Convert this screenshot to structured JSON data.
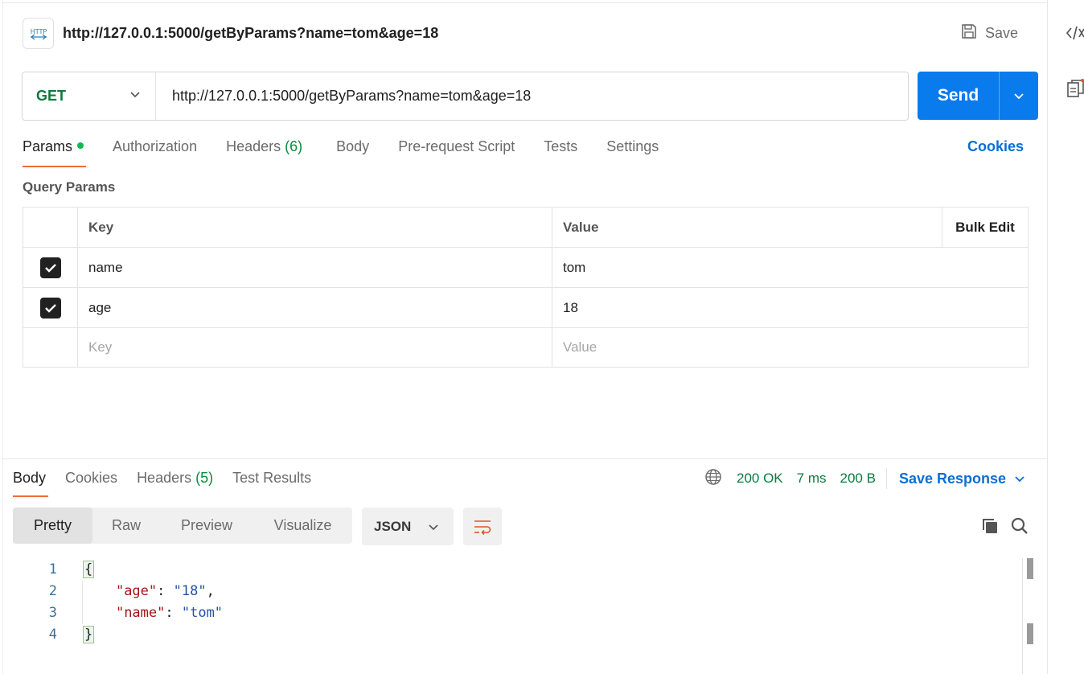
{
  "header": {
    "badge_text": "HTTP",
    "request_title": "http://127.0.0.1:5000/getByParams?name=tom&age=18",
    "save_label": "Save"
  },
  "request": {
    "method": "GET",
    "url": "http://127.0.0.1:5000/getByParams?name=tom&age=18",
    "send_label": "Send"
  },
  "request_tabs": {
    "params": "Params",
    "authorization": "Authorization",
    "headers": "Headers",
    "headers_count": "(6)",
    "body": "Body",
    "pre_request": "Pre-request Script",
    "tests": "Tests",
    "settings": "Settings",
    "cookies": "Cookies"
  },
  "query_params": {
    "title": "Query Params",
    "columns": {
      "key": "Key",
      "value": "Value",
      "bulk_edit": "Bulk Edit"
    },
    "rows": [
      {
        "key": "name",
        "value": "tom",
        "checked": true
      },
      {
        "key": "age",
        "value": "18",
        "checked": true
      }
    ],
    "placeholder_key": "Key",
    "placeholder_value": "Value"
  },
  "response": {
    "tabs": {
      "body": "Body",
      "cookies": "Cookies",
      "headers": "Headers",
      "headers_count": "(5)",
      "test_results": "Test Results"
    },
    "status": "200 OK",
    "time": "7 ms",
    "size": "200 B",
    "save_response": "Save Response",
    "views": [
      "Pretty",
      "Raw",
      "Preview",
      "Visualize"
    ],
    "format": "JSON",
    "code_lines": [
      {
        "n": "1"
      },
      {
        "n": "2",
        "key": "\"age\"",
        "colon": ": ",
        "val": "\"18\"",
        "tail": ","
      },
      {
        "n": "3",
        "key": "\"name\"",
        "colon": ": ",
        "val": "\"tom\"",
        "tail": ""
      },
      {
        "n": "4"
      }
    ],
    "open_brace": "{",
    "close_brace": "}"
  },
  "colors": {
    "accent_blue": "#097bed",
    "tab_underline": "#f26b3a",
    "success_green": "#0b7a3e"
  }
}
